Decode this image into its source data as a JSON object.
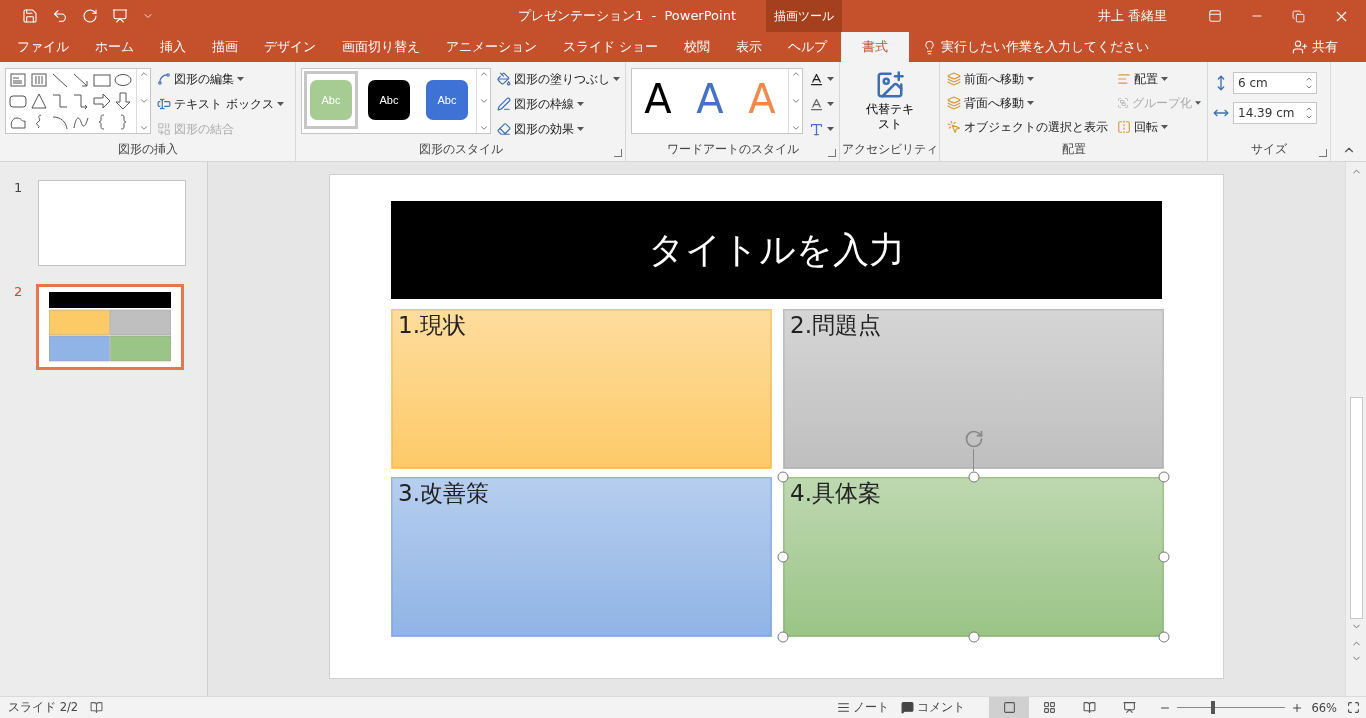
{
  "title_bar": {
    "title": "プレゼンテーション1  -  PowerPoint",
    "context_label": "描画ツール",
    "user": "井上 香緒里"
  },
  "ribbon_tabs": [
    {
      "label": "ファイル",
      "selected": false
    },
    {
      "label": "ホーム",
      "selected": false
    },
    {
      "label": "挿入",
      "selected": false
    },
    {
      "label": "描画",
      "selected": false
    },
    {
      "label": "デザイン",
      "selected": false
    },
    {
      "label": "画面切り替え",
      "selected": false
    },
    {
      "label": "アニメーション",
      "selected": false
    },
    {
      "label": "スライド ショー",
      "selected": false
    },
    {
      "label": "校閲",
      "selected": false
    },
    {
      "label": "表示",
      "selected": false
    },
    {
      "label": "ヘルプ",
      "selected": false
    },
    {
      "label": "書式",
      "selected": true
    }
  ],
  "tell_me": {
    "placeholder": "実行したい作業を入力してください"
  },
  "share": "共有",
  "ribbon": {
    "insert_shapes": {
      "label": "図形の挿入",
      "commands": [
        {
          "label": "図形の編集",
          "disabled": false
        },
        {
          "label": "テキスト ボックス",
          "disabled": false
        },
        {
          "label": "図形の結合",
          "disabled": true
        }
      ]
    },
    "shape_styles": {
      "label": "図形のスタイル",
      "presets": [
        {
          "text": "Abc",
          "color": "#a6cb93",
          "selected": true
        },
        {
          "text": "Abc",
          "color": "#000000",
          "selected": false
        },
        {
          "text": "Abc",
          "color": "#3e72d4",
          "selected": false
        }
      ],
      "commands": [
        "図形の塗りつぶし",
        "図形の枠線",
        "図形の効果"
      ]
    },
    "wordart": {
      "label": "ワードアートのスタイル",
      "presets": [
        {
          "text": "A",
          "color": "#000000"
        },
        {
          "text": "A",
          "color": "#4472c4"
        },
        {
          "text": "A",
          "color": "#f08a4b"
        }
      ]
    },
    "accessibility": {
      "label": "アクセシビリティ",
      "command": "代替テキスト"
    },
    "arrange": {
      "label": "配置",
      "commands": [
        {
          "kind": "front",
          "label": "前面へ移動",
          "disabled": false
        },
        {
          "kind": "back",
          "label": "背面へ移動",
          "disabled": false
        },
        {
          "kind": "pane",
          "label": "オブジェクトの選択と表示",
          "disabled": false
        },
        {
          "kind": "align",
          "label": "配置",
          "disabled": false
        },
        {
          "kind": "group",
          "label": "グループ化",
          "disabled": true
        },
        {
          "kind": "rotate",
          "label": "回転",
          "disabled": false
        }
      ]
    },
    "size": {
      "label": "サイズ",
      "height": "6 cm",
      "width": "14.39 cm"
    }
  },
  "slides": [
    {
      "number": "1",
      "kind": "blank",
      "selected": false
    },
    {
      "number": "2",
      "kind": "content",
      "selected": true
    }
  ],
  "slide": {
    "title": "タイトルを入力",
    "boxes": [
      {
        "label": "1.現状",
        "color": "#fdca68",
        "selected": false
      },
      {
        "label": "2.問題点",
        "color": "#bfbfbf",
        "selected": false
      },
      {
        "label": "3.改善策",
        "color": "#90b4e6",
        "selected": false
      },
      {
        "label": "4.具体案",
        "color": "#9bc487",
        "selected": true
      }
    ]
  },
  "status_bar": {
    "slide_counter": "スライド 2/2",
    "notes": "ノート",
    "comments": "コメント",
    "views": [
      {
        "kind": "normal",
        "selected": true
      },
      {
        "kind": "sorter",
        "selected": false
      },
      {
        "kind": "reading",
        "selected": false
      },
      {
        "kind": "slideshow",
        "selected": false
      }
    ],
    "zoom": {
      "level": 0.33,
      "reading": "66%"
    }
  }
}
